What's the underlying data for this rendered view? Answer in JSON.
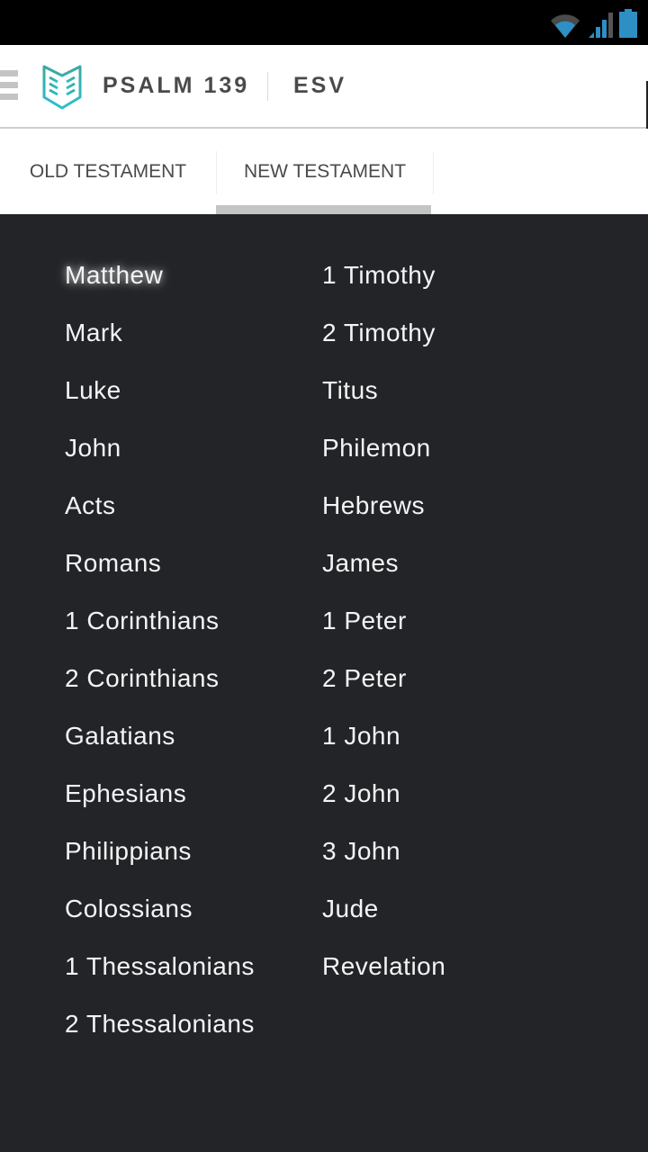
{
  "status_bar": {
    "icons": [
      "wifi-icon",
      "cell-signal-icon",
      "battery-icon"
    ],
    "accent_color": "#2e8fc4"
  },
  "header": {
    "menu_icon": "hamburger-menu-icon",
    "logo_icon": "open-book-logo-icon",
    "title": "PSALM 139",
    "version": "ESV",
    "brand_color": "#2bb8b8"
  },
  "tabs": [
    {
      "label": "OLD TESTAMENT",
      "selected": false
    },
    {
      "label": "NEW TESTAMENT",
      "selected": true
    }
  ],
  "books": {
    "left_column": [
      "Matthew",
      "Mark",
      "Luke",
      "John",
      "Acts",
      "Romans",
      "1 Corinthians",
      "2 Corinthians",
      "Galatians",
      "Ephesians",
      "Philippians",
      "Colossians",
      "1 Thessalonians",
      "2 Thessalonians"
    ],
    "right_column": [
      "1 Timothy",
      "2 Timothy",
      "Titus",
      "Philemon",
      "Hebrews",
      "James",
      "1 Peter",
      "2 Peter",
      "1 John",
      "2 John",
      "3 John",
      "Jude",
      "Revelation"
    ],
    "highlighted": "Matthew"
  }
}
